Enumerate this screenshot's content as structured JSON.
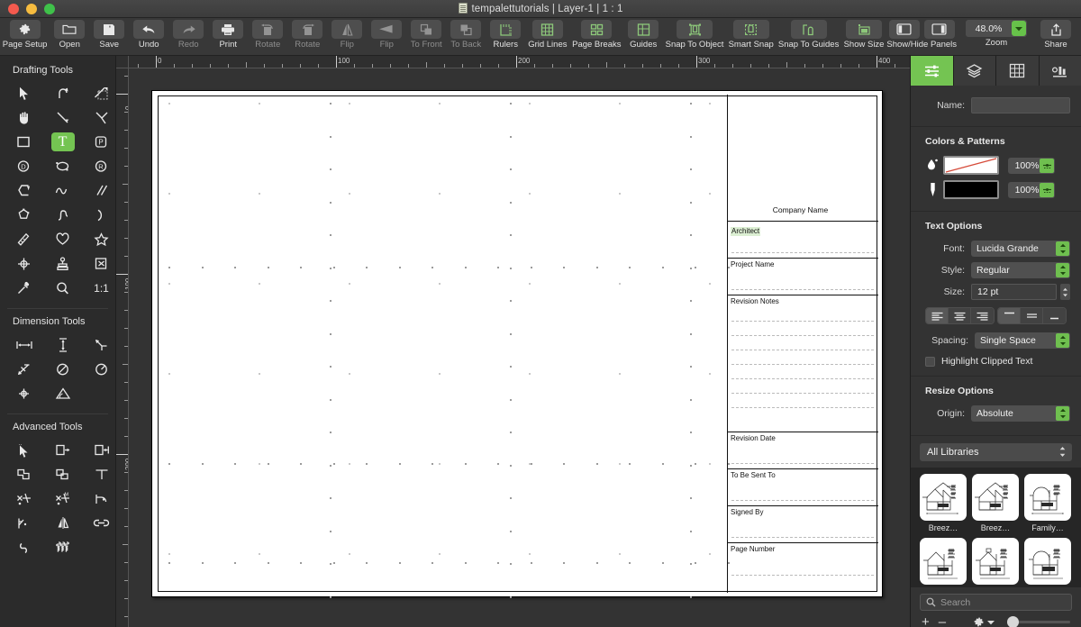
{
  "window": {
    "title": "tempalettutorials | Layer-1 | 1 : 1",
    "doc_icon": "document-icon",
    "controls": [
      "close",
      "minimize",
      "maximize"
    ]
  },
  "toolbar": {
    "items": [
      {
        "label": "Page Setup",
        "icon": "gear-icon",
        "enabled": true
      },
      {
        "label": "Open",
        "icon": "folder-icon",
        "enabled": true
      },
      {
        "label": "Save",
        "icon": "floppy-disk-icon",
        "enabled": true
      },
      {
        "label": "Undo",
        "icon": "undo-arrow-icon",
        "enabled": true
      },
      {
        "label": "Redo",
        "icon": "redo-arrow-icon",
        "enabled": false
      },
      {
        "label": "Print",
        "icon": "printer-icon",
        "enabled": true
      },
      {
        "label": "Rotate",
        "icon": "rotate-left-icon",
        "enabled": false
      },
      {
        "label": "Rotate",
        "icon": "rotate-right-icon",
        "enabled": false
      },
      {
        "label": "Flip",
        "icon": "flip-vertical-icon",
        "enabled": false
      },
      {
        "label": "Flip",
        "icon": "flip-horizontal-icon",
        "enabled": false
      },
      {
        "label": "To Front",
        "icon": "bring-to-front-icon",
        "enabled": false
      },
      {
        "label": "To Back",
        "icon": "send-to-back-icon",
        "enabled": false
      },
      {
        "label": "Rulers",
        "icon": "rulers-icon",
        "enabled": true
      },
      {
        "label": "Grid Lines",
        "icon": "grid-lines-icon",
        "enabled": true
      },
      {
        "label": "Page Breaks",
        "icon": "page-breaks-icon",
        "enabled": true
      },
      {
        "label": "Guides",
        "icon": "guides-icon",
        "enabled": true
      },
      {
        "label": "Snap To Object",
        "icon": "snap-to-object-icon",
        "enabled": true
      },
      {
        "label": "Smart Snap",
        "icon": "smart-snap-icon",
        "enabled": true
      },
      {
        "label": "Snap To Guides",
        "icon": "snap-to-guides-icon",
        "enabled": true
      },
      {
        "label": "Show Size",
        "icon": "show-size-icon",
        "enabled": true
      }
    ],
    "panels_label": "Show/Hide Panels",
    "zoom_label": "Zoom",
    "zoom_value": "48.0%",
    "share_label": "Share",
    "share_icon": "share-upload-icon"
  },
  "sidebar": {
    "sections": [
      {
        "title": "Drafting Tools",
        "tools": [
          {
            "name": "selection-arrow-tool",
            "active": false
          },
          {
            "name": "rotate-tool",
            "active": false
          },
          {
            "name": "marquee-select-tool",
            "active": false
          },
          {
            "name": "pan-hand-tool",
            "active": false
          },
          {
            "name": "line-tool",
            "active": false
          },
          {
            "name": "double-line-tool",
            "active": false
          },
          {
            "name": "rectangle-tool",
            "active": false
          },
          {
            "name": "text-tool",
            "active": true,
            "glyph": "T"
          },
          {
            "name": "polygon-p-tool",
            "active": false
          },
          {
            "name": "dimension-d-tool",
            "active": false
          },
          {
            "name": "oval-tool",
            "active": false
          },
          {
            "name": "radius-r-tool",
            "active": false
          },
          {
            "name": "chamfer-tool",
            "active": false
          },
          {
            "name": "wave-curve-tool",
            "active": false
          },
          {
            "name": "parallel-lines-tool",
            "active": false
          },
          {
            "name": "polygon-shape-tool",
            "active": false
          },
          {
            "name": "spline-tool",
            "active": false
          },
          {
            "name": "arc-tool",
            "active": false
          },
          {
            "name": "freehand-pencil-tool",
            "active": false
          },
          {
            "name": "heart-shape-tool",
            "active": false
          },
          {
            "name": "star-shape-tool",
            "active": false
          },
          {
            "name": "center-mark-tool",
            "active": false
          },
          {
            "name": "stamp-symbol-tool",
            "active": false
          },
          {
            "name": "clipping-box-tool",
            "active": false
          },
          {
            "name": "eyedropper-tool",
            "active": false
          },
          {
            "name": "zoom-magnifier-tool",
            "active": false
          },
          {
            "name": "scale-one-to-one-tool",
            "active": false,
            "glyph": "1:1"
          }
        ]
      },
      {
        "title": "Dimension Tools",
        "tools": [
          {
            "name": "horizontal-dimension-tool"
          },
          {
            "name": "vertical-dimension-tool"
          },
          {
            "name": "leader-line-tool"
          },
          {
            "name": "callout-tool"
          },
          {
            "name": "diameter-dimension-tool"
          },
          {
            "name": "radial-dimension-tool"
          },
          {
            "name": "center-point-tool"
          },
          {
            "name": "angular-dimension-tool"
          }
        ]
      },
      {
        "title": "Advanced Tools",
        "tools": [
          {
            "name": "smart-select-tool"
          },
          {
            "name": "offset-right-tool"
          },
          {
            "name": "offset-distance-tool"
          },
          {
            "name": "union-shape-tool"
          },
          {
            "name": "subtract-shape-tool"
          },
          {
            "name": "trim-tool"
          },
          {
            "name": "break-line-tool"
          },
          {
            "name": "break-line-m-tool"
          },
          {
            "name": "fillet-tool"
          },
          {
            "name": "join-tool"
          },
          {
            "name": "mirror-tool"
          },
          {
            "name": "link-chain-tool"
          },
          {
            "name": "reverse-curve-tool"
          },
          {
            "name": "hatch-pattern-tool"
          }
        ]
      }
    ]
  },
  "rulers": {
    "horizontal_ticks": [
      "0",
      "100",
      "200",
      "300",
      "400"
    ],
    "vertical_ticks": [
      "0",
      "100",
      "200"
    ],
    "unit_spacing_px": 200
  },
  "canvas": {
    "title_block": {
      "company_name": "Company Name",
      "fields": [
        {
          "label": "Architect",
          "selected": true
        },
        {
          "label": "Project Name",
          "selected": false
        },
        {
          "label": "Revision Notes",
          "selected": false
        },
        {
          "label": "Revision Date",
          "selected": false
        },
        {
          "label": "To Be Sent To",
          "selected": false
        },
        {
          "label": "Signed By",
          "selected": false
        },
        {
          "label": "Page Number",
          "selected": false
        }
      ]
    }
  },
  "inspector": {
    "tabs": [
      {
        "name": "object-info-tab",
        "icon": "sliders-icon",
        "active": true
      },
      {
        "name": "layers-tab",
        "icon": "layers-stack-icon",
        "active": false
      },
      {
        "name": "grid-tab",
        "icon": "grid-table-icon",
        "active": false
      },
      {
        "name": "chart-tab",
        "icon": "bar-chart-icon",
        "active": false
      }
    ],
    "name_label": "Name:",
    "name_value": "",
    "colors": {
      "title": "Colors & Patterns",
      "fill": {
        "icon": "fill-drop-icon",
        "swatch": "none",
        "opacity": "100%"
      },
      "stroke": {
        "icon": "stroke-pen-icon",
        "swatch": "#000000",
        "opacity": "100%"
      }
    },
    "text_options": {
      "title": "Text Options",
      "font_label": "Font:",
      "font_value": "Lucida Grande",
      "style_label": "Style:",
      "style_value": "Regular",
      "size_label": "Size:",
      "size_value": "12 pt",
      "align_options": [
        "align-left",
        "align-center",
        "align-right"
      ],
      "align_selected": "align-left",
      "vertical_options": [
        "v-align-top",
        "v-align-middle",
        "v-align-bottom"
      ],
      "vertical_selected": "v-align-top",
      "spacing_label": "Spacing:",
      "spacing_value": "Single Space",
      "highlight_label": "Highlight Clipped Text",
      "highlight_checked": false
    },
    "resize_options": {
      "title": "Resize Options",
      "origin_label": "Origin:",
      "origin_value": "Absolute"
    },
    "libraries": {
      "selector_value": "All Libraries",
      "items": [
        {
          "name": "Breez…"
        },
        {
          "name": "Breez…"
        },
        {
          "name": "Family…"
        },
        {
          "name": ""
        },
        {
          "name": ""
        },
        {
          "name": ""
        }
      ],
      "search_placeholder": "Search",
      "add_label": "+",
      "remove_label": "–",
      "gear_icon": "gear-icon"
    }
  },
  "colors": {
    "accent_green": "#74c452",
    "titlebar": "#3c3c3c",
    "panel_bg": "#333333",
    "canvas_bg": "#333333",
    "page": "#ffffff"
  }
}
